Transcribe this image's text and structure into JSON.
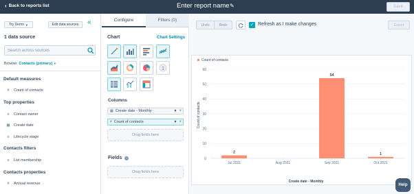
{
  "topbar": {
    "back_label": "Back to reports list",
    "report_title": "Enter report name",
    "save_label": "Save"
  },
  "left": {
    "account_label": "Try Demo",
    "edit_sources_label": "Edit data sources",
    "data_source_count": "1 data source",
    "search_placeholder": "Search across sources",
    "browse_label": "Browse:",
    "browse_value": "Contacts (primary)",
    "sections": [
      {
        "title": "Default measures",
        "items": [
          {
            "icon": "hash-icon",
            "label": "Count of contacts"
          }
        ]
      },
      {
        "title": "Top properties",
        "items": [
          {
            "icon": "list-icon",
            "label": "Contact owner"
          },
          {
            "icon": "calendar-icon",
            "label": "Create date"
          },
          {
            "icon": "list-icon",
            "label": "Lifecycle stage"
          }
        ]
      },
      {
        "title": "Contacts filters",
        "items": [
          {
            "icon": "list-icon",
            "label": "List membership"
          }
        ]
      },
      {
        "title": "Contacts properties",
        "items": [
          {
            "icon": "hash-icon",
            "label": "Annual revenue"
          }
        ]
      }
    ]
  },
  "middle": {
    "tabs": [
      {
        "label": "Configure"
      },
      {
        "label": "Filters (0)"
      }
    ],
    "chart_heading": "Chart",
    "chart_settings_label": "Chart Settings",
    "columns_heading": "Columns",
    "column_chips": [
      {
        "icon": "calendar-icon",
        "label": "Create date - Monthly"
      },
      {
        "icon": "hash-icon",
        "label": "Count of contacts"
      }
    ],
    "drag_fields_label": "Drag fields here",
    "fields_heading": "Fields"
  },
  "right": {
    "undo_label": "Undo",
    "redo_label": "Redo",
    "refresh_label": "Refresh as I make changes",
    "refresh_checked": true,
    "export_label": "Export",
    "help_label": "Help"
  },
  "colors": {
    "accent": "#00a4bd",
    "bar": "#ff8f73",
    "topbar": "#2d3e50"
  },
  "chart_data": {
    "type": "bar",
    "categories": [
      "Jul 2021",
      "Aug 2021",
      "Sep 2021",
      "Oct 2021"
    ],
    "series": [
      {
        "name": "Count of contacts",
        "values": [
          2,
          0,
          54,
          1
        ]
      }
    ],
    "data_labels": [
      "2",
      "",
      "54",
      "1"
    ],
    "xlabel": "Create date - Monthly",
    "ylabel": "Count of contacts",
    "ylim": [
      0,
      60
    ],
    "yticks": [
      0,
      10,
      20,
      30,
      40,
      50,
      60
    ],
    "legend": "top-left",
    "grid": true
  }
}
